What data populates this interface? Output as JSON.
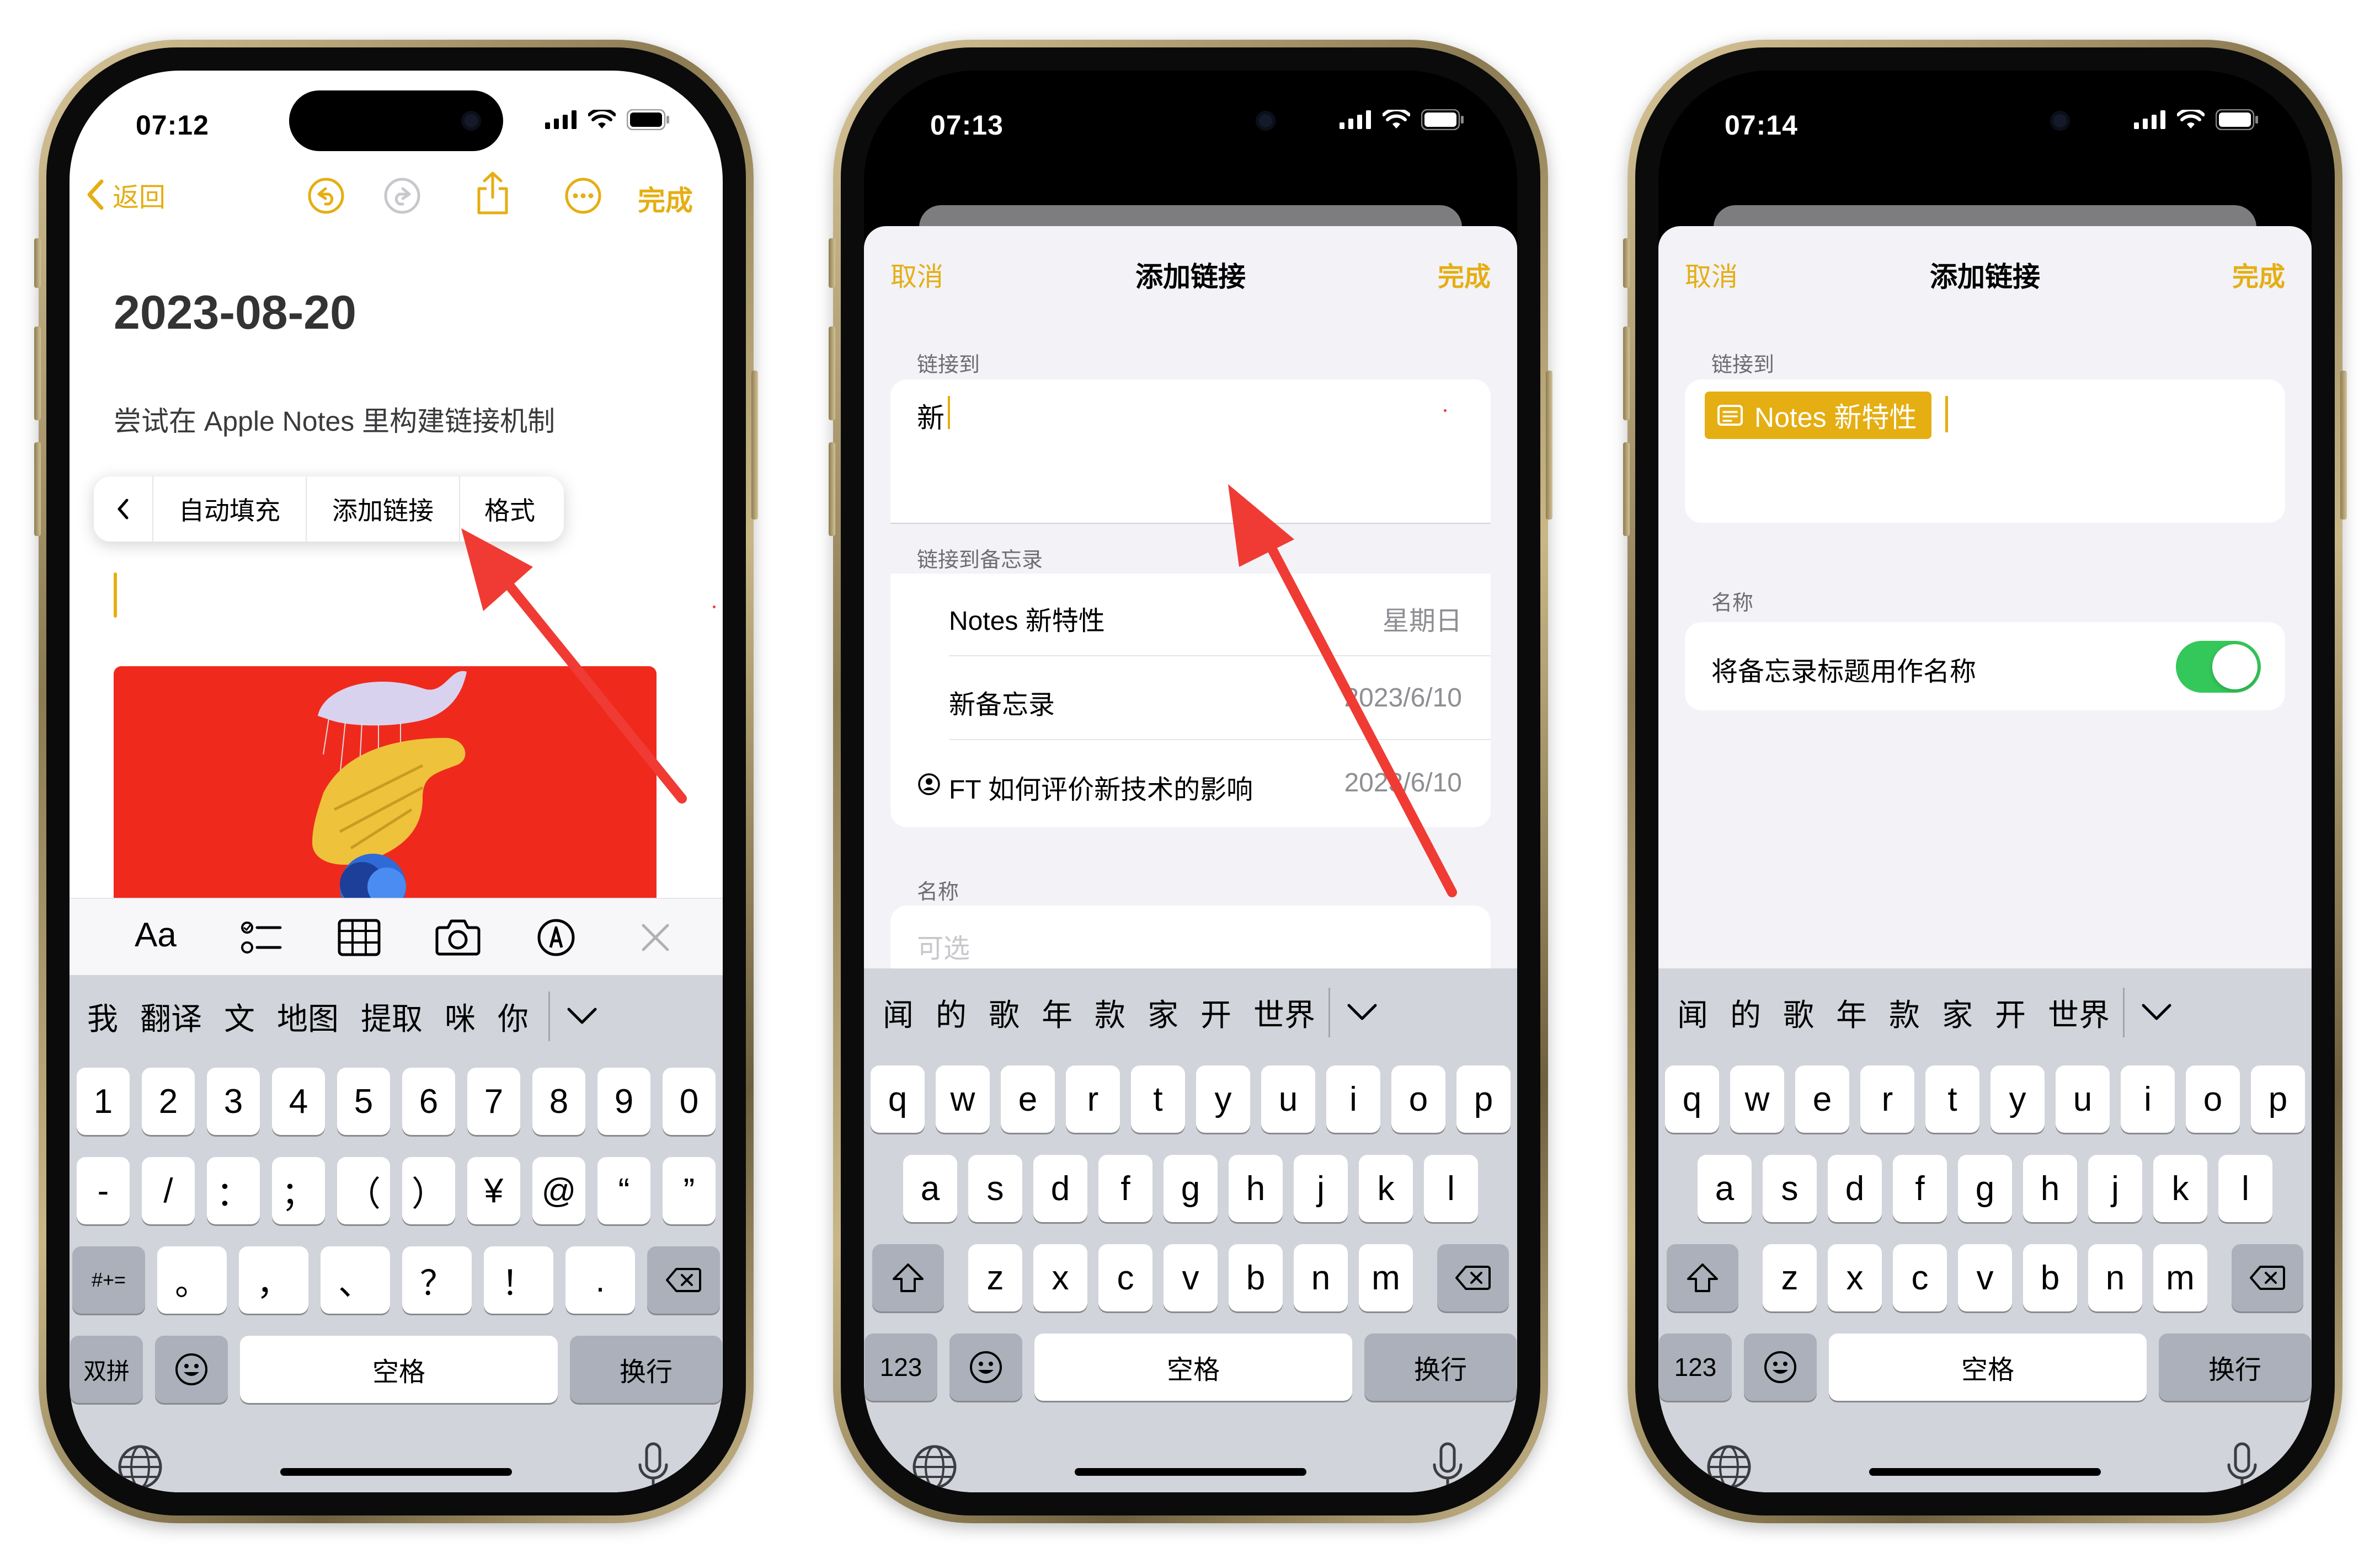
{
  "phones": [
    {
      "status": {
        "time": "07:12"
      },
      "nav": {
        "back_label": "返回",
        "done_label": "完成"
      },
      "note": {
        "title": "2023-08-20",
        "body": "尝试在 Apple Notes 里构建链接机制"
      },
      "context_menu": {
        "chevron": "<",
        "items": [
          "自动填充",
          "添加链接",
          "格式"
        ]
      },
      "format_toolbar": {
        "text_style_label": "Aa"
      },
      "keyboard": {
        "candidates": [
          "我",
          "翻译",
          "文",
          "地图",
          "提取",
          "咪",
          "你"
        ],
        "row1": [
          "1",
          "2",
          "3",
          "4",
          "5",
          "6",
          "7",
          "8",
          "9",
          "0"
        ],
        "row2": [
          "-",
          "/",
          "：",
          "；",
          "（",
          "）",
          "¥",
          "@",
          "“",
          "”"
        ],
        "row3_left": "#+=",
        "row3": [
          "。",
          "，",
          "、",
          "？",
          "！",
          "."
        ],
        "mode_key": "双拼",
        "space_label": "空格",
        "return_label": "换行"
      }
    },
    {
      "status": {
        "time": "07:13"
      },
      "sheet": {
        "cancel_label": "取消",
        "title": "添加链接",
        "done_label": "完成"
      },
      "link_to": {
        "label": "链接到",
        "value": "新"
      },
      "link_to_note": {
        "label": "链接到备忘录",
        "rows": [
          {
            "title": "Notes 新特性",
            "date": "星期日"
          },
          {
            "title": "新备忘录",
            "date": "2023/6/10"
          },
          {
            "title": "FT 如何评价新技术的影响",
            "date": "2023/6/10"
          }
        ]
      },
      "name": {
        "label": "名称",
        "placeholder": "可选"
      },
      "keyboard": {
        "candidates": [
          "闻",
          "的",
          "歌",
          "年",
          "款",
          "家",
          "开",
          "世界"
        ],
        "row1": [
          "q",
          "w",
          "e",
          "r",
          "t",
          "y",
          "u",
          "i",
          "o",
          "p"
        ],
        "row2": [
          "a",
          "s",
          "d",
          "f",
          "g",
          "h",
          "j",
          "k",
          "l"
        ],
        "row3": [
          "z",
          "x",
          "c",
          "v",
          "b",
          "n",
          "m"
        ],
        "mode_key": "123",
        "space_label": "空格",
        "return_label": "换行"
      }
    },
    {
      "status": {
        "time": "07:14"
      },
      "sheet": {
        "cancel_label": "取消",
        "title": "添加链接",
        "done_label": "完成"
      },
      "link_to": {
        "label": "链接到",
        "chip": "Notes 新特性"
      },
      "name": {
        "label": "名称",
        "toggle_label": "将备忘录标题用作名称",
        "toggle_on": true
      },
      "keyboard": {
        "candidates": [
          "闻",
          "的",
          "歌",
          "年",
          "款",
          "家",
          "开",
          "世界"
        ],
        "row1": [
          "q",
          "w",
          "e",
          "r",
          "t",
          "y",
          "u",
          "i",
          "o",
          "p"
        ],
        "row2": [
          "a",
          "s",
          "d",
          "f",
          "g",
          "h",
          "j",
          "k",
          "l"
        ],
        "row3": [
          "z",
          "x",
          "c",
          "v",
          "b",
          "n",
          "m"
        ],
        "mode_key": "123",
        "space_label": "空格",
        "return_label": "换行"
      }
    }
  ],
  "colors": {
    "accent": "#e5ae12",
    "annotation_arrow": "#ef3b33",
    "toggle_on": "#34c759",
    "image_red": "#ef2a1d"
  }
}
